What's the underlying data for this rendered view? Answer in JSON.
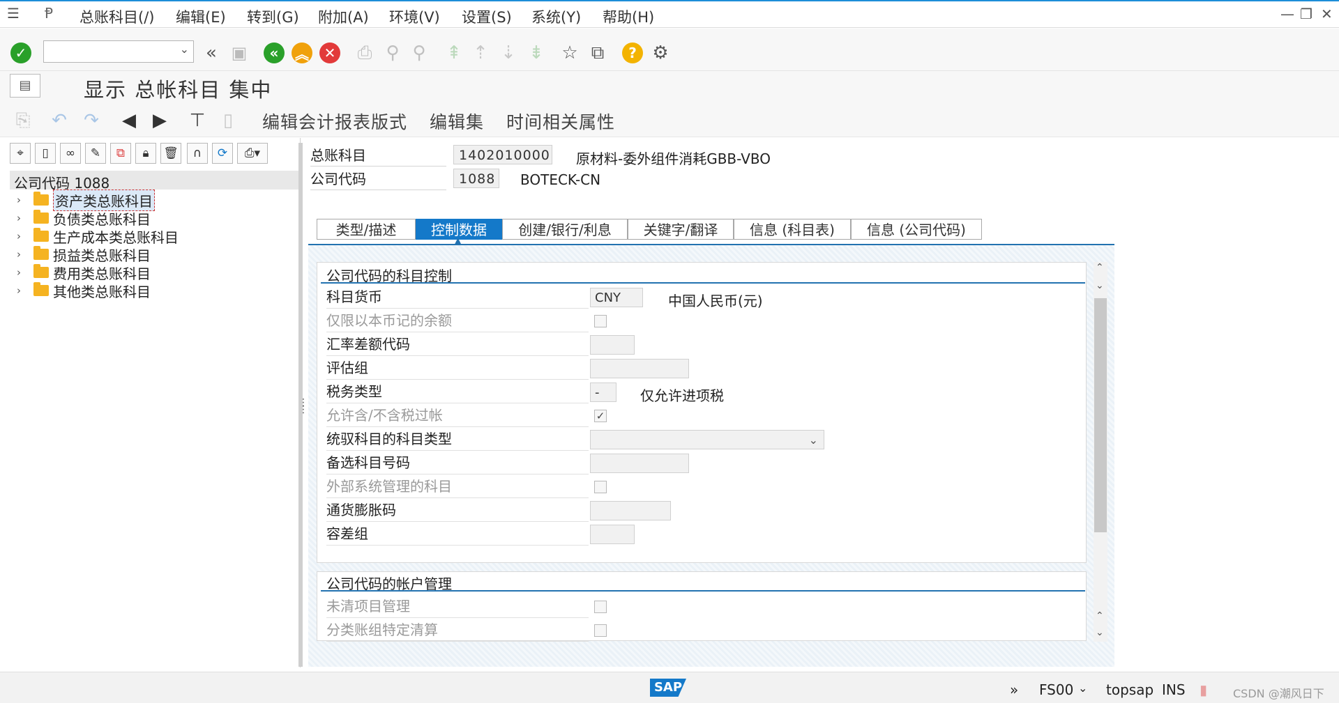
{
  "menu": {
    "items": [
      "总账科目(/)",
      "编辑(E)",
      "转到(G)",
      "附加(A)",
      "环境(V)",
      "设置(S)",
      "系统(Y)",
      "帮助(H)"
    ]
  },
  "toolbar": {
    "command_field_value": "",
    "icons": [
      "enter-check-icon",
      "command-dropdown-icon",
      "double-left-icon",
      "save-icon",
      "back-icon",
      "exit-icon",
      "cancel-icon",
      "print-icon",
      "find-icon",
      "find-next-icon",
      "first-page-icon",
      "prev-page-icon",
      "next-page-icon",
      "last-page-icon",
      "new-session-icon",
      "shortcut-icon",
      "help-icon",
      "customize-icon"
    ]
  },
  "title": "显示 总帐科目 集中",
  "app_toolbar": {
    "buttons": [
      "编辑会计报表版式",
      "编辑集",
      "时间相关属性"
    ]
  },
  "tree": {
    "root": "公司代码 1088",
    "nodes": [
      "资产类总账科目",
      "负债类总账科目",
      "生产成本类总账科目",
      "损益类总账科目",
      "费用类总账科目",
      "其他类总账科目"
    ]
  },
  "header": {
    "gl_account_label": "总账科目",
    "gl_account_value": "1402010000",
    "gl_account_desc": "原材料-委外组件消耗GBB-VBO",
    "company_code_label": "公司代码",
    "company_code_value": "1088",
    "company_code_desc": "BOTECK-CN"
  },
  "tabs": [
    "类型/描述",
    "控制数据",
    "创建/银行/利息",
    "关键字/翻译",
    "信息 (科目表)",
    "信息 (公司代码)"
  ],
  "active_tab": "控制数据",
  "group1": {
    "title": "公司代码的科目控制",
    "rows": {
      "currency_label": "科目货币",
      "currency_value": "CNY",
      "currency_desc": "中国人民币(元)",
      "local_only_label": "仅限以本币记的余额",
      "exch_diff_label": "汇率差额代码",
      "valuation_label": "评估组",
      "tax_cat_label": "税务类型",
      "tax_cat_value": "-",
      "tax_cat_desc": "仅允许进项税",
      "posting_wo_tax_label": "允许含/不含税过帐",
      "recon_label": "统驭科目的科目类型",
      "alt_acct_label": "备选科目号码",
      "ext_mgmt_label": "外部系统管理的科目",
      "inflation_label": "通货膨胀码",
      "tolerance_label": "容差组"
    }
  },
  "group2": {
    "title": "公司代码的帐户管理",
    "rows": {
      "open_item_label": "未清项目管理",
      "ledger_group_label": "分类账组特定清算"
    }
  },
  "status": {
    "transaction": "FS00",
    "system": "topsap",
    "mode": "INS",
    "watermark": "CSDN @潮风日下",
    "logo": "SAP"
  },
  "colors": {
    "accent": "#1479c9",
    "ok_green": "#2aa02a",
    "exit_orange": "#f0a10b",
    "cancel_red": "#e23a3a",
    "help_yellow": "#f3b300",
    "folder": "#f5b321"
  }
}
